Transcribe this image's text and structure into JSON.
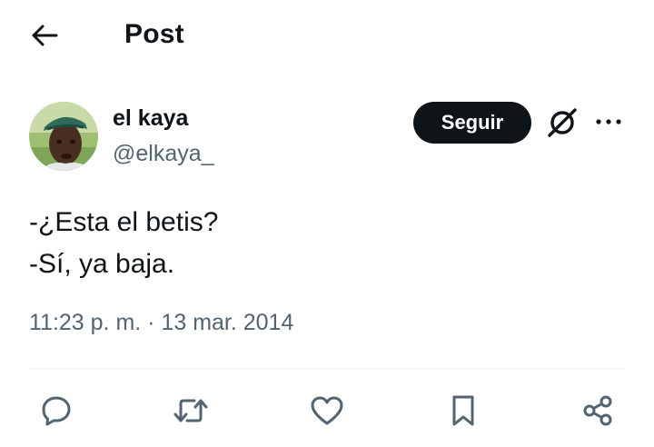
{
  "header": {
    "title": "Post",
    "back_icon": "arrow-left-icon"
  },
  "author": {
    "name": "el kaya",
    "handle": "@elkaya_",
    "avatar": "profile-photo"
  },
  "follow_button": {
    "label": "Seguir"
  },
  "icons": {
    "grok": "grok-icon",
    "more": "more-horizontal-icon",
    "reply": "reply-icon",
    "repost": "repost-icon",
    "like": "like-heart-icon",
    "bookmark": "bookmark-icon",
    "share": "share-icon"
  },
  "tweet": {
    "lines": [
      "-¿Esta el betis?",
      "-Sí, ya baja."
    ],
    "timestamp": "11:23 p. m. · 13 mar. 2014"
  },
  "colors": {
    "text": "#0f1419",
    "secondary": "#536471",
    "button_bg": "#0f1419",
    "divider": "#eff3f4"
  }
}
